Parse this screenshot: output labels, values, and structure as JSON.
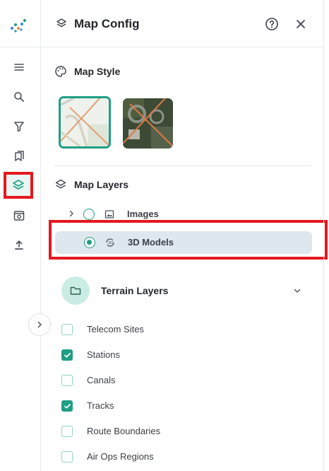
{
  "panel": {
    "title": "Map Config",
    "icons": {
      "title": "layers-icon",
      "help": "help-circle-icon",
      "close": "close-icon"
    }
  },
  "rail": {
    "items": [
      {
        "name": "menu",
        "icon": "hamburger-icon",
        "active": false
      },
      {
        "name": "search",
        "icon": "search-icon",
        "active": false
      },
      {
        "name": "filter",
        "icon": "filter-icon",
        "active": false
      },
      {
        "name": "bookmarks",
        "icon": "bookmarks-icon",
        "active": false
      },
      {
        "name": "map-config",
        "icon": "layers-icon",
        "active": true
      },
      {
        "name": "preview",
        "icon": "eye-window-icon",
        "active": false
      },
      {
        "name": "upload",
        "icon": "upload-icon",
        "active": false
      }
    ],
    "collapse_icon": "chevron-right-icon"
  },
  "map_style": {
    "heading": "Map Style",
    "icon": "palette-icon",
    "options": [
      {
        "name": "street",
        "selected": true
      },
      {
        "name": "satellite",
        "selected": false
      }
    ]
  },
  "map_layers": {
    "heading": "Map Layers",
    "icon": "layers-icon",
    "rows": [
      {
        "label": "Images",
        "checked": false,
        "selected": false,
        "icon": "image-icon",
        "expandable": true
      },
      {
        "label": "3D Models",
        "checked": true,
        "selected": true,
        "icon": "rotate-3d-icon",
        "expandable": false
      }
    ]
  },
  "terrain": {
    "heading": "Terrain Layers",
    "icon": "folder-icon",
    "expanded": true,
    "items": [
      {
        "label": "Telecom Sites",
        "checked": false
      },
      {
        "label": "Stations",
        "checked": true
      },
      {
        "label": "Canals",
        "checked": false
      },
      {
        "label": "Tracks",
        "checked": true
      },
      {
        "label": "Route Boundaries",
        "checked": false
      },
      {
        "label": "Air Ops Regions",
        "checked": false
      }
    ]
  },
  "colors": {
    "accent": "#1f9e84",
    "highlight": "#e3191f"
  }
}
